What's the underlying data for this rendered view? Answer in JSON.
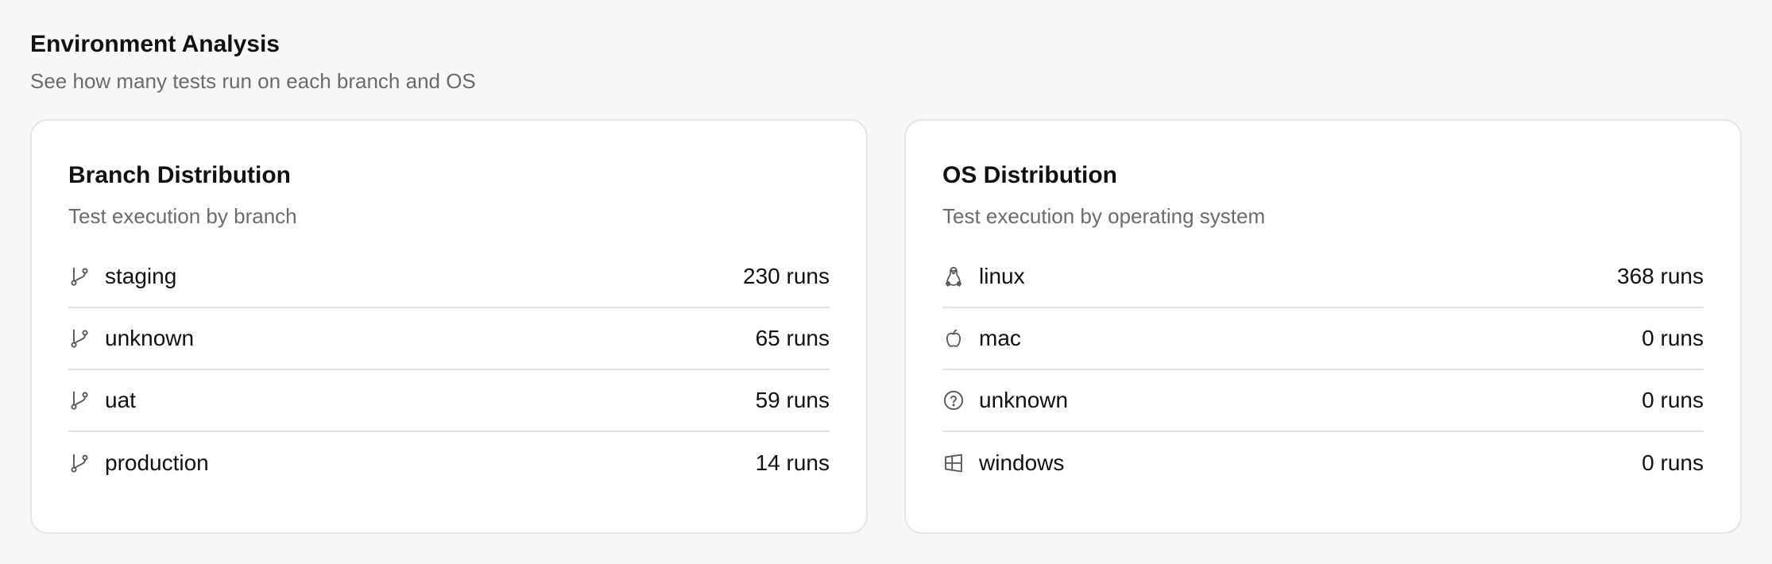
{
  "header": {
    "title": "Environment Analysis",
    "subtitle": "See how many tests run on each branch and OS"
  },
  "branch_card": {
    "title": "Branch Distribution",
    "subtitle": "Test execution by branch",
    "items": [
      {
        "icon": "git-branch-icon",
        "label": "staging",
        "value": "230 runs"
      },
      {
        "icon": "git-branch-icon",
        "label": "unknown",
        "value": "65 runs"
      },
      {
        "icon": "git-branch-icon",
        "label": "uat",
        "value": "59 runs"
      },
      {
        "icon": "git-branch-icon",
        "label": "production",
        "value": "14 runs"
      }
    ]
  },
  "os_card": {
    "title": "OS Distribution",
    "subtitle": "Test execution by operating system",
    "items": [
      {
        "icon": "linux-icon",
        "label": "linux",
        "value": "368 runs"
      },
      {
        "icon": "apple-icon",
        "label": "mac",
        "value": "0 runs"
      },
      {
        "icon": "question-circle-icon",
        "label": "unknown",
        "value": "0 runs"
      },
      {
        "icon": "windows-icon",
        "label": "windows",
        "value": "0 runs"
      }
    ]
  },
  "colors": {
    "background": "#f8f8f8",
    "card": "#ffffff",
    "border": "#e5e5e5",
    "text": "#111111",
    "muted": "#6b6b6b",
    "icon": "#555555"
  }
}
